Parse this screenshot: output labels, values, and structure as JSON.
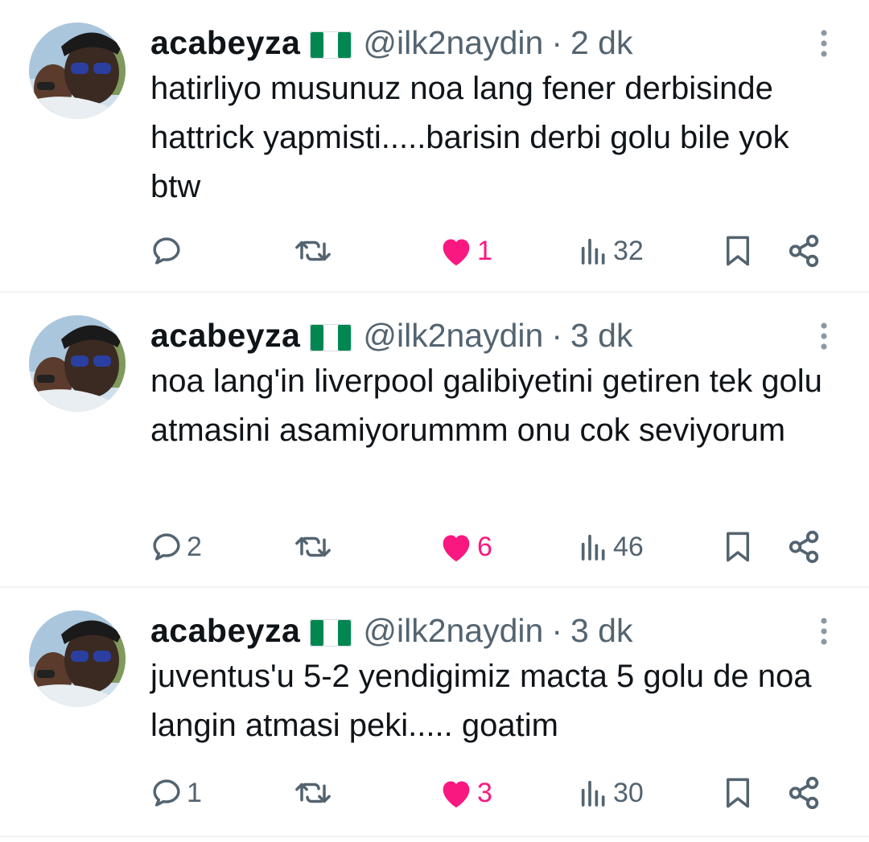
{
  "tweets": [
    {
      "display_name": "acabeyza",
      "handle": "@ilk2naydin",
      "separator": "·",
      "time": "2 dk",
      "text": "hatirliyo musunuz noa lang fener derbisinde hattrick yapmisti.....barisin derbi golu bile yok btw",
      "reply_count": "",
      "like_count": "1",
      "view_count": "32"
    },
    {
      "display_name": "acabeyza",
      "handle": "@ilk2naydin",
      "separator": "·",
      "time": "3 dk",
      "text": "noa lang'in liverpool galibiyetini getiren tek golu atmasini asamiyorummm onu cok seviyorum",
      "reply_count": "2",
      "like_count": "6",
      "view_count": "46"
    },
    {
      "display_name": "acabeyza",
      "handle": "@ilk2naydin",
      "separator": "·",
      "time": "3 dk",
      "text": "juventus'u 5-2 yendigimiz macta 5 golu de noa langin atmasi peki..... goatim",
      "reply_count": "1",
      "like_count": "3",
      "view_count": "30"
    }
  ],
  "icons": {
    "flag": "nigeria-flag-icon",
    "more": "more-vertical-icon",
    "reply": "reply-icon",
    "retweet": "retweet-icon",
    "like": "heart-filled-icon",
    "views": "views-icon",
    "bookmark": "bookmark-icon",
    "share": "share-icon"
  },
  "colors": {
    "text": "#0f1419",
    "secondary": "#536471",
    "like": "#f91880",
    "flag_green": "#008751",
    "divider": "#eff3f4"
  }
}
